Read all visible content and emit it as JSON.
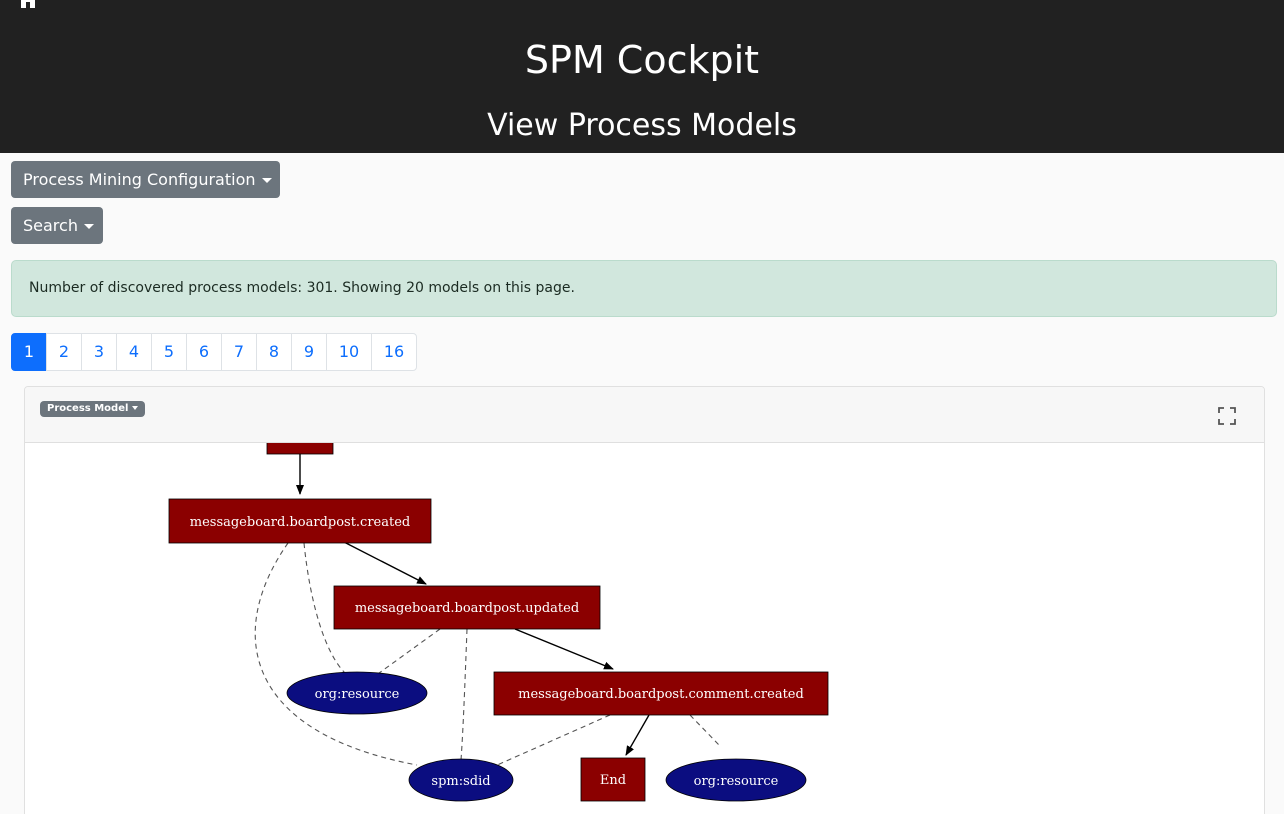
{
  "header": {
    "app_title": "SPM Cockpit",
    "page_title": "View Process Models",
    "home_icon": "home-icon"
  },
  "toolbar": {
    "config_label": "Process Mining Configuration",
    "search_label": "Search"
  },
  "alert": {
    "text": "Number of discovered process models: 301. Showing 20 models on this page."
  },
  "pagination": {
    "pages": [
      "1",
      "2",
      "3",
      "4",
      "5",
      "6",
      "7",
      "8",
      "9",
      "10",
      "16"
    ],
    "active": "1"
  },
  "model_card": {
    "dropdown_label": "Process Model",
    "fullscreen_icon": "expand-icon",
    "graph": {
      "colors": {
        "activity": "#8b0000",
        "resource": "#0b0d80",
        "text": "#ffffff",
        "edge": "#000000"
      },
      "nodes": {
        "created": "messageboard.boardpost.created",
        "updated": "messageboard.boardpost.updated",
        "comment_created": "messageboard.boardpost.comment.created",
        "end": "End",
        "resource_1": "org:resource",
        "sdid": "spm:sdid",
        "resource_2": "org:resource"
      }
    }
  }
}
